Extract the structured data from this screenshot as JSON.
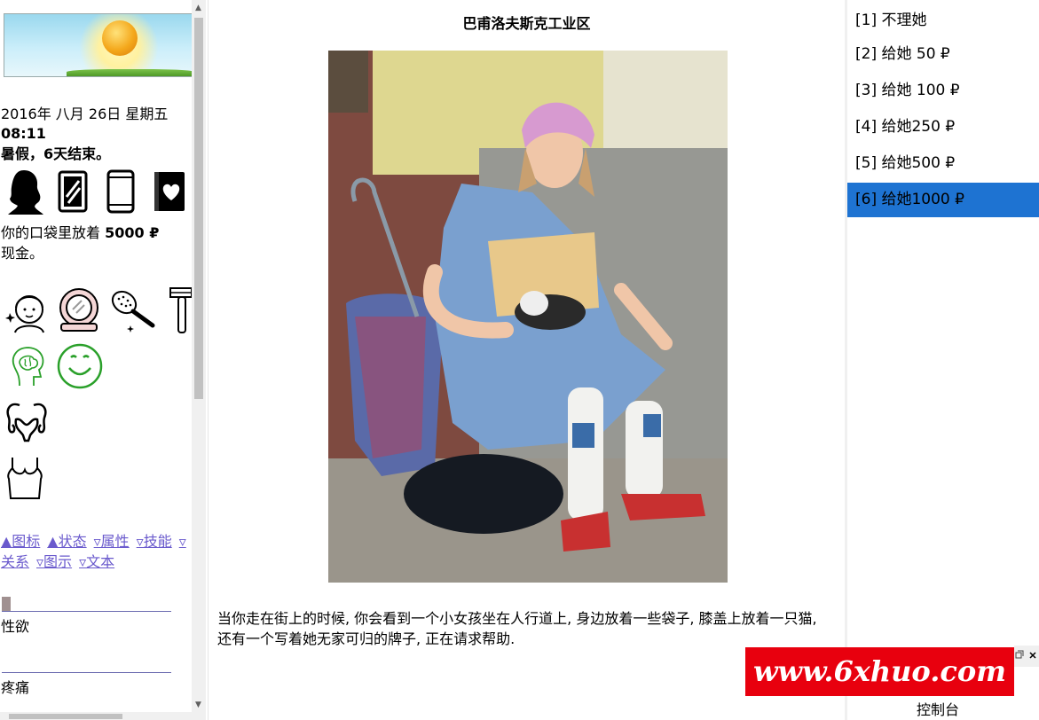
{
  "left": {
    "date": "2016年 八月 26日 星期五",
    "time": "08:11",
    "holiday": "暑假，6天结束。",
    "money_prefix": "你的口袋里放着 ",
    "money_amount": "5000 ₽",
    "money_suffix": "现金。",
    "top_icons": [
      "woman-silhouette-icon",
      "mirror-icon",
      "smartphone-icon",
      "heart-book-icon"
    ],
    "care_icons": [
      "face-care-icon",
      "compact-mirror-icon",
      "hairbrush-icon",
      "razor-icon"
    ],
    "status_icons": [
      "brain-icon",
      "smile-icon"
    ],
    "body_icons": [
      "uterus-icon",
      "bra-top-icon"
    ],
    "links": [
      "▲图标",
      "▲状态",
      "▿属性",
      "▿技能",
      "▿关系",
      "▿图示",
      "▿文本"
    ],
    "bars": [
      {
        "label": "性欲",
        "level": 0.05
      },
      {
        "label": "疼痛",
        "level": 0
      }
    ],
    "colors": {
      "link": "#6a5acd",
      "status_green": "#2aa02a"
    }
  },
  "center": {
    "title": "巴甫洛夫斯克工业区",
    "description": "当你走在街上的时候, 你会看到一个小女孩坐在人行道上, 身边放着一些袋子, 膝盖上放着一只猫, 还有一个写着她无家可归的牌子, 正在请求帮助."
  },
  "right": {
    "choices": [
      {
        "label": "[1] 不理她",
        "selected": false
      },
      {
        "label": "[2] 给她 50 ₽",
        "selected": false
      },
      {
        "label": "[3] 给她 100 ₽",
        "selected": false
      },
      {
        "label": "[4] 给她250 ₽",
        "selected": false
      },
      {
        "label": "[5] 给她500 ₽",
        "selected": false
      },
      {
        "label": "[6] 给她1000 ₽",
        "selected": true
      }
    ],
    "console": "控制台",
    "selected_color": "#1e73d2"
  },
  "watermark": "www.6xhuo.com"
}
